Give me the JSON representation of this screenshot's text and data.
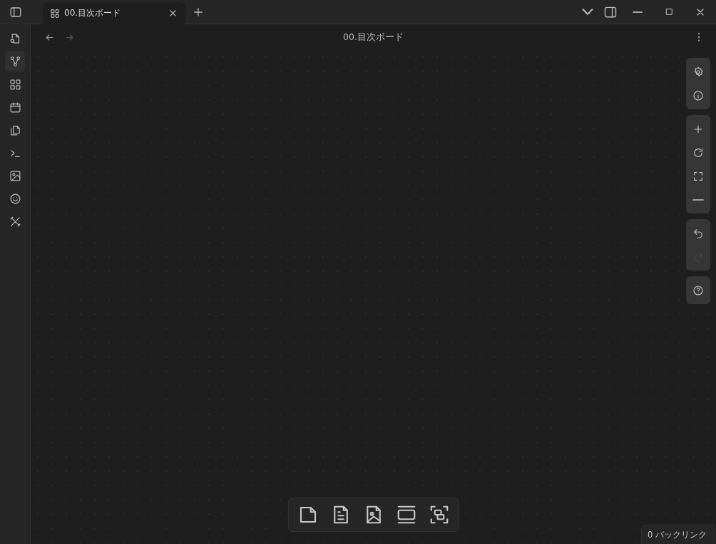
{
  "window": {
    "tabs": [
      {
        "title": "00.目次ボード",
        "selected": true
      }
    ]
  },
  "view": {
    "title": "00.目次ボード",
    "nav": [
      {
        "kind": "back",
        "disabled": false
      },
      {
        "kind": "forward",
        "disabled": true
      }
    ]
  },
  "canvas_controls": [
    {
      "items": [
        {
          "kind": "settings",
          "disabled": false
        },
        {
          "kind": "info",
          "disabled": false
        }
      ]
    },
    {
      "items": [
        {
          "kind": "zoom-in",
          "disabled": false
        },
        {
          "kind": "reset",
          "disabled": false
        },
        {
          "kind": "fit",
          "disabled": false
        },
        {
          "kind": "zoom-out",
          "disabled": false
        }
      ]
    },
    {
      "items": [
        {
          "kind": "undo",
          "disabled": false
        },
        {
          "kind": "redo",
          "disabled": true
        }
      ]
    },
    {
      "items": [
        {
          "kind": "help",
          "disabled": false
        }
      ]
    }
  ],
  "status_bar": {
    "backlinks": "0 バックリンク"
  }
}
